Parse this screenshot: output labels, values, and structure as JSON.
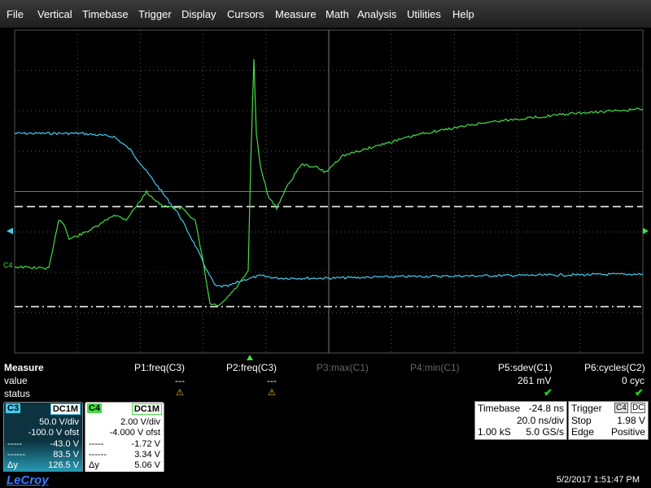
{
  "menu": [
    "File",
    "Vertical",
    "Timebase",
    "Trigger",
    "Display",
    "Cursors",
    "Measure",
    "Math",
    "Analysis",
    "Utilities",
    "Help"
  ],
  "channels": {
    "c3_color": "#44ccee",
    "c4_color": "#44dd44",
    "c4_marker": "C4"
  },
  "measure": {
    "title": "Measure",
    "row_value": "value",
    "row_status": "status",
    "params": [
      {
        "label": "P1:freq(C3)",
        "value": "---",
        "status": "warn",
        "active": true
      },
      {
        "label": "P2:freq(C3)",
        "value": "---",
        "status": "warn",
        "active": true
      },
      {
        "label": "P3:max(C1)",
        "value": "",
        "status": "",
        "active": false
      },
      {
        "label": "P4:min(C1)",
        "value": "",
        "status": "",
        "active": false
      },
      {
        "label": "P5:sdev(C1)",
        "value": "261 mV",
        "status": "ok",
        "active": true
      },
      {
        "label": "P6:cycles(C2)",
        "value": "0 cyc",
        "status": "ok",
        "active": true
      }
    ]
  },
  "c3": {
    "name": "C3",
    "coupling": "DC1M",
    "vdiv": "50.0 V/div",
    "ofst": "-100.0 V ofst",
    "cur1_label": "-----",
    "cur1": "-43.0 V",
    "cur2_label": "------",
    "cur2": "83.5 V",
    "dy_label": "Δy",
    "dy": "126.5 V"
  },
  "c4": {
    "name": "C4",
    "coupling": "DC1M",
    "vdiv": "2.00 V/div",
    "ofst": "-4.000 V ofst",
    "cur1_label": "-----",
    "cur1": "-1.72 V",
    "cur2_label": "------",
    "cur2": "3.34 V",
    "dy_label": "Δy",
    "dy": "5.06 V"
  },
  "timebase": {
    "label": "Timebase",
    "delay": "-24.8 ns",
    "tdiv": "20.0 ns/div",
    "samples": "1.00 kS",
    "rate": "5.0 GS/s"
  },
  "trigger": {
    "label": "Trigger",
    "source": "C4",
    "coupling": "DC",
    "mode": "Stop",
    "level": "1.98 V",
    "type": "Edge",
    "slope": "Positive"
  },
  "footer": {
    "logo": "LeCroy",
    "datetime": "5/2/2017 1:51:47 PM"
  }
}
